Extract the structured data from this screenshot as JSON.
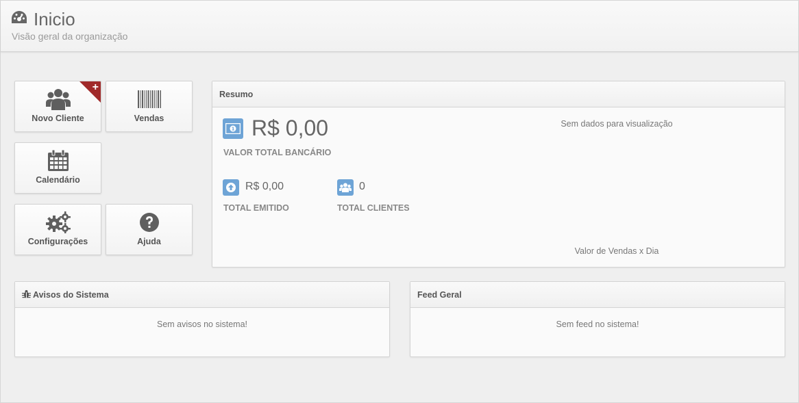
{
  "header": {
    "title": "Inicio",
    "subtitle": "Visão geral da organização",
    "icon": "dashboard-icon"
  },
  "tiles": {
    "novo_cliente": {
      "label": "Novo Cliente",
      "icon": "users-icon",
      "badge": "+"
    },
    "vendas": {
      "label": "Vendas",
      "icon": "barcode-icon"
    },
    "calendario": {
      "label": "Calendário",
      "icon": "calendar-icon"
    },
    "configuracoes": {
      "label": "Configurações",
      "icon": "gears-icon"
    },
    "ajuda": {
      "label": "Ajuda",
      "icon": "question-icon"
    }
  },
  "resumo": {
    "title": "Resumo",
    "valor_total": "R$ 0,00",
    "valor_total_label": "VALOR TOTAL BANCÁRIO",
    "total_emitido": "R$ 0,00",
    "total_emitido_label": "TOTAL EMITIDO",
    "total_clientes": "0",
    "total_clientes_label": "TOTAL CLIENTES",
    "sem_dados": "Sem dados para visualização",
    "grafico_label": "Valor de Vendas x Dia"
  },
  "avisos": {
    "title": "Avisos do Sistema",
    "message": "Sem avisos no sistema!"
  },
  "feed": {
    "title": "Feed Geral",
    "message": "Sem feed no sistema!"
  },
  "colors": {
    "accent_blue": "#6ea4d6",
    "badge_red": "#a02a2a",
    "icon_gray": "#5f5f5f"
  }
}
